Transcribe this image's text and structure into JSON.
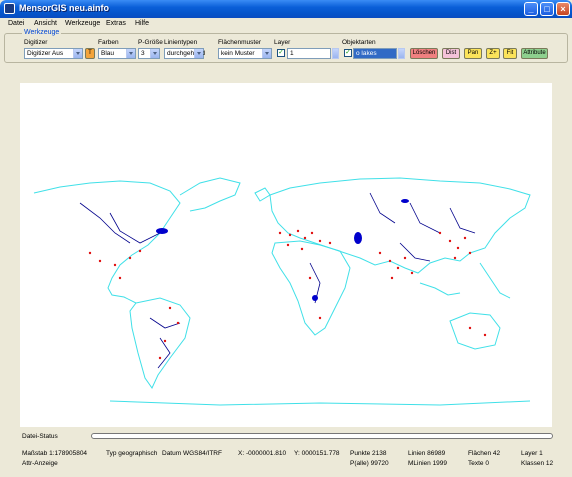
{
  "window": {
    "title": "MensorGIS neu.ainfo"
  },
  "menu": [
    "Datei",
    "Ansicht",
    "Werkzeuge",
    "Extras",
    "Hilfe"
  ],
  "tools": {
    "group_title": "Werkzeuge",
    "digitizer": {
      "label": "Digitizer",
      "value": "Digitizer Aus"
    },
    "colors": {
      "label": "Farben",
      "value": "Blau"
    },
    "point_size": {
      "label": "P-Größe",
      "value": "3"
    },
    "line_types": {
      "label": "Linientypen",
      "value": "durchgehend"
    },
    "fill_patterns": {
      "label": "Flächenmuster",
      "value": "kein Muster"
    },
    "layer": {
      "label": "Layer",
      "value": "1"
    },
    "object_types": {
      "label": "Objektarten",
      "value": "o lakes"
    },
    "buttons": {
      "delete": "Löschen",
      "dist": "Dist",
      "pan": "Pan",
      "zoom_in": "Z+",
      "fit": "Fit",
      "attributes": "Attribute"
    },
    "t_button": "T"
  },
  "status": {
    "file_status": "Datei-Status",
    "attr_display": "Attr-Anzeige",
    "scale": "Maßstab  1:178905804",
    "type": "Typ  geographisch",
    "datum": "Datum  WGS84/ITRF",
    "x": "X:  -0000001.810",
    "y": "Y:  0000151.778",
    "points": "Punkte  2138",
    "p_all": "P(alle)  99720",
    "lines": "Linien  86989",
    "mlines": "MLinien  1999",
    "areas": "Flächen  42",
    "texts": "Texte  0",
    "layer_count": "Layer  1",
    "classes": "Klassen  12"
  },
  "colors": {
    "coastline": "#40e0e8",
    "rivers": "#00008b",
    "points": "#e01010",
    "lakes": "#0000cc"
  }
}
